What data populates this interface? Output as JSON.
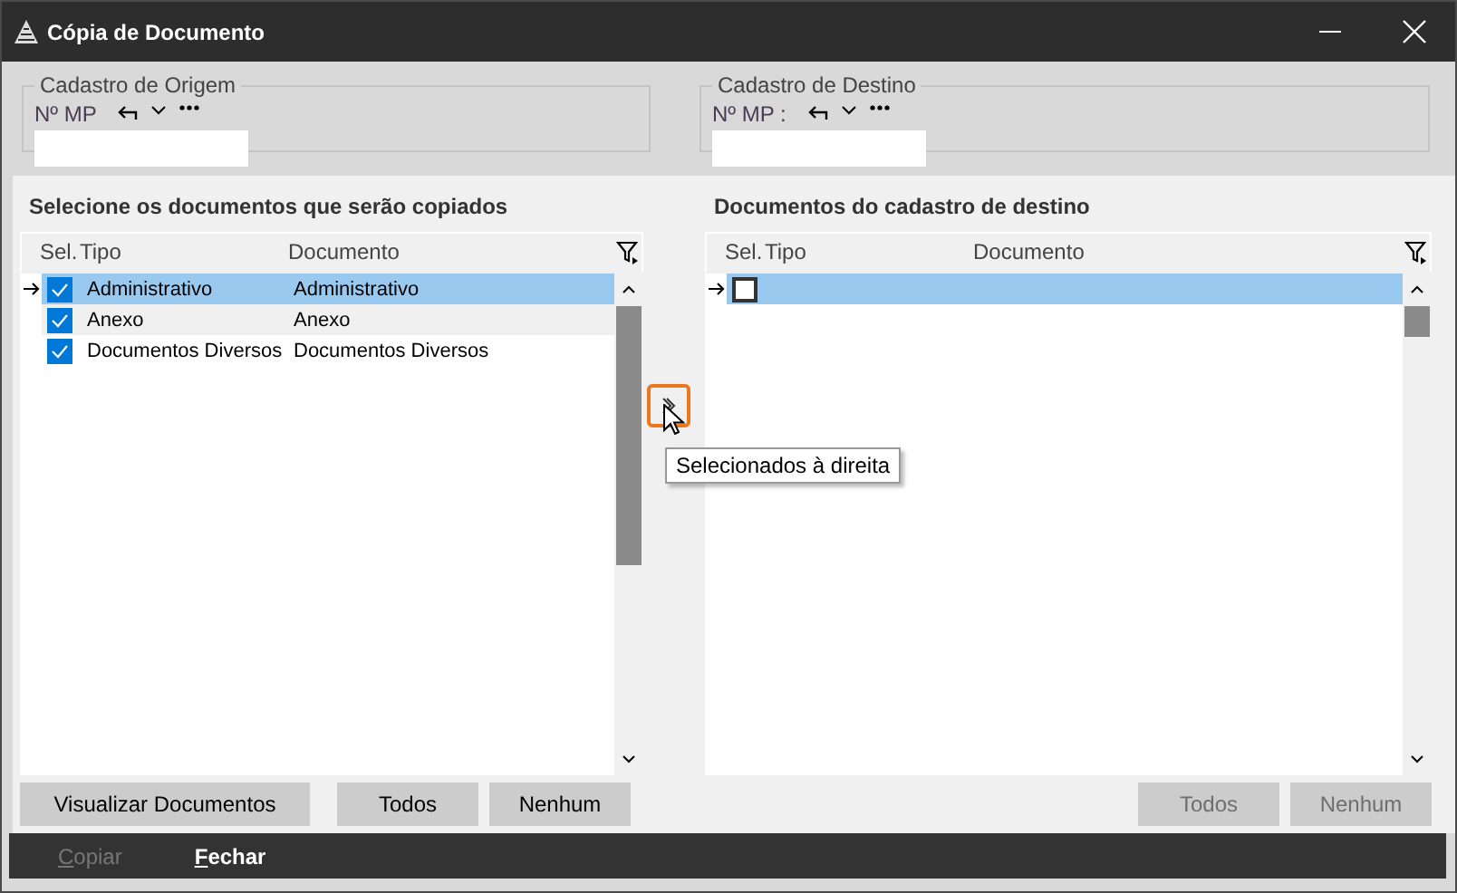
{
  "window": {
    "title": "Cópia de Documento"
  },
  "origin": {
    "legend": "Cadastro de Origem",
    "label": "Nº MP"
  },
  "destination": {
    "legend": "Cadastro de Destino",
    "label": "Nº MP :"
  },
  "source_panel": {
    "heading": "Selecione os documentos que serão copiados",
    "columns": [
      "Sel.",
      "Tipo",
      "Documento"
    ],
    "rows": [
      {
        "checked": true,
        "selected": true,
        "current": true,
        "hovered": false,
        "tipo": "Administrativo",
        "documento": "Administrativo"
      },
      {
        "checked": true,
        "selected": false,
        "current": false,
        "hovered": true,
        "tipo": "Anexo",
        "documento": "Anexo"
      },
      {
        "checked": true,
        "selected": false,
        "current": false,
        "hovered": false,
        "tipo": "Documentos Diversos",
        "documento": "Documentos Diversos"
      }
    ],
    "buttons": [
      {
        "label": "Visualizar Documentos",
        "disabled": false
      },
      {
        "label": "Todos",
        "disabled": false
      },
      {
        "label": "Nenhum",
        "disabled": false
      }
    ]
  },
  "transfer_button": {
    "focused": true,
    "tooltip": "Selecionados à direita"
  },
  "target_panel": {
    "heading": "Documentos do cadastro de destino",
    "columns": [
      "Sel.",
      "Tipo",
      "Documento"
    ],
    "rows": [
      {
        "checked": false,
        "selected": true,
        "current": true,
        "hovered": false
      }
    ],
    "buttons": [
      {
        "label": "Todos",
        "disabled": true
      },
      {
        "label": "Nenhum",
        "disabled": true
      }
    ]
  },
  "footer": {
    "buttons": [
      {
        "label": "Copiar",
        "disabled": true
      },
      {
        "label": "Fechar",
        "disabled": false
      }
    ]
  }
}
